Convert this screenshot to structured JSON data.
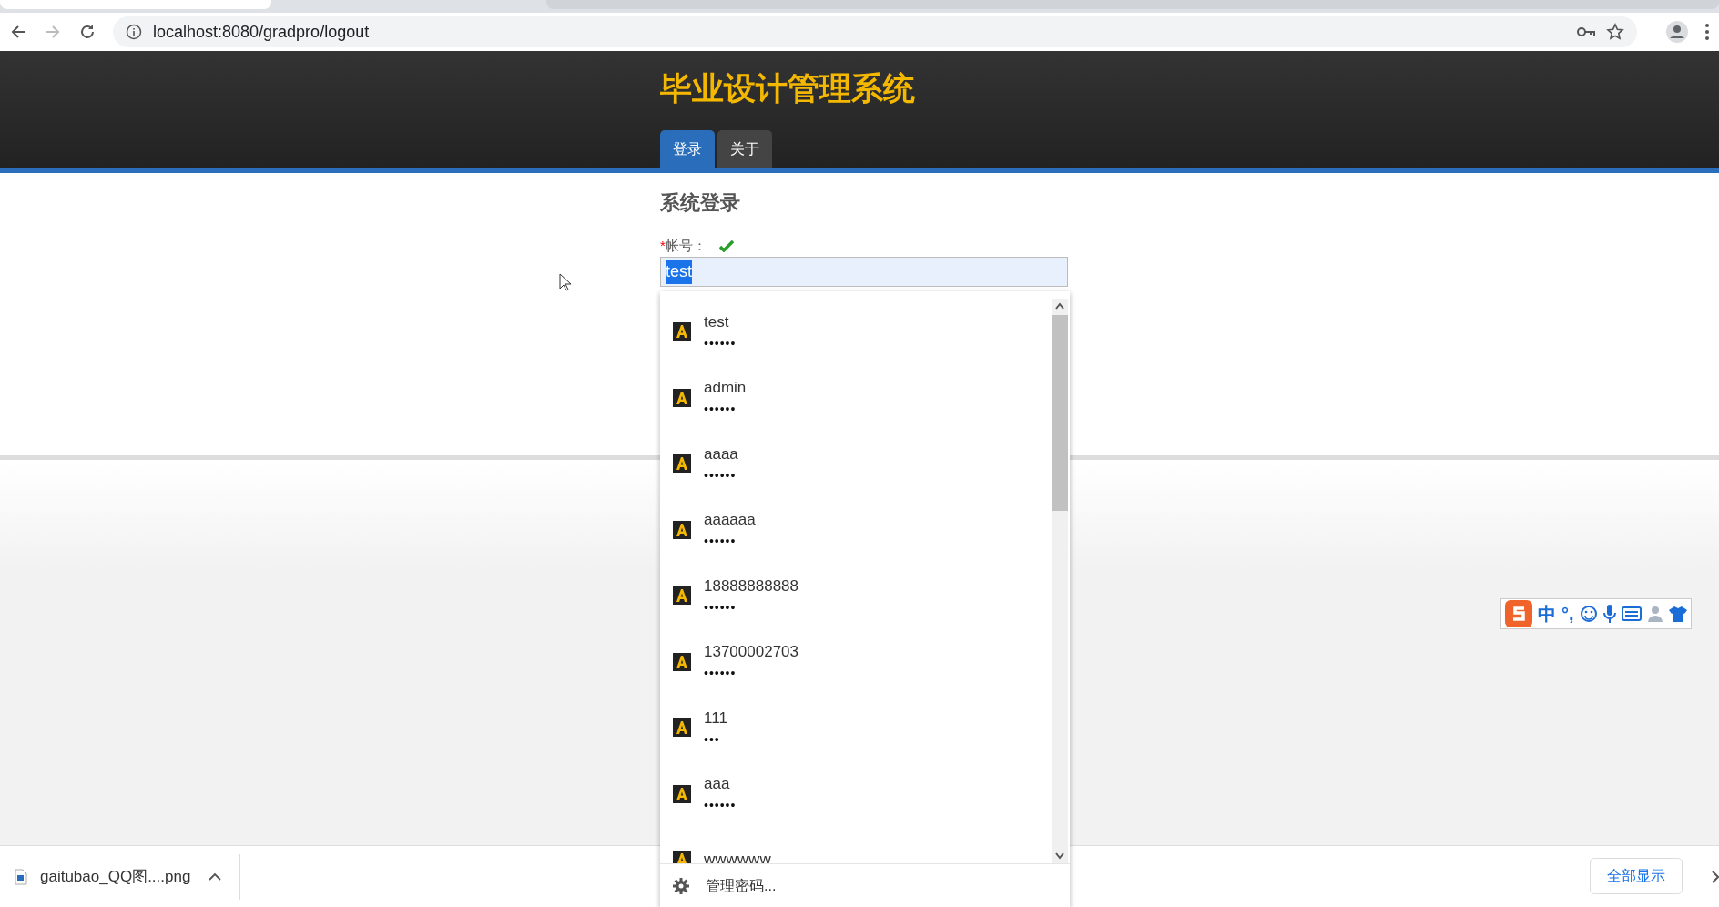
{
  "browser": {
    "url": "localhost:8080/gradpro/logout"
  },
  "header": {
    "title": "毕业设计管理系统",
    "nav": [
      {
        "label": "登录",
        "selected": true
      },
      {
        "label": "关于",
        "selected": false
      }
    ]
  },
  "form": {
    "heading": "系统登录",
    "field": {
      "required_mark": "*",
      "label": "帐号：",
      "valid": true,
      "value": "test",
      "text_selected": true
    }
  },
  "autofill": {
    "items": [
      {
        "username": "test",
        "password": "••••••"
      },
      {
        "username": "admin",
        "password": "••••••"
      },
      {
        "username": "aaaa",
        "password": "••••••"
      },
      {
        "username": "aaaaaa",
        "password": "••••••"
      },
      {
        "username": "18888888888",
        "password": "••••••"
      },
      {
        "username": "13700002703",
        "password": "••••••"
      },
      {
        "username": "111",
        "password": "•••"
      },
      {
        "username": "aaa",
        "password": "••••••"
      },
      {
        "username": "wwwwww"
      }
    ],
    "footer": "管理密码..."
  },
  "ime": {
    "mode": "中",
    "punctuation": "°,"
  },
  "download_bar": {
    "file": "gaitubao_QQ图....png",
    "show_all": "全部显示"
  }
}
